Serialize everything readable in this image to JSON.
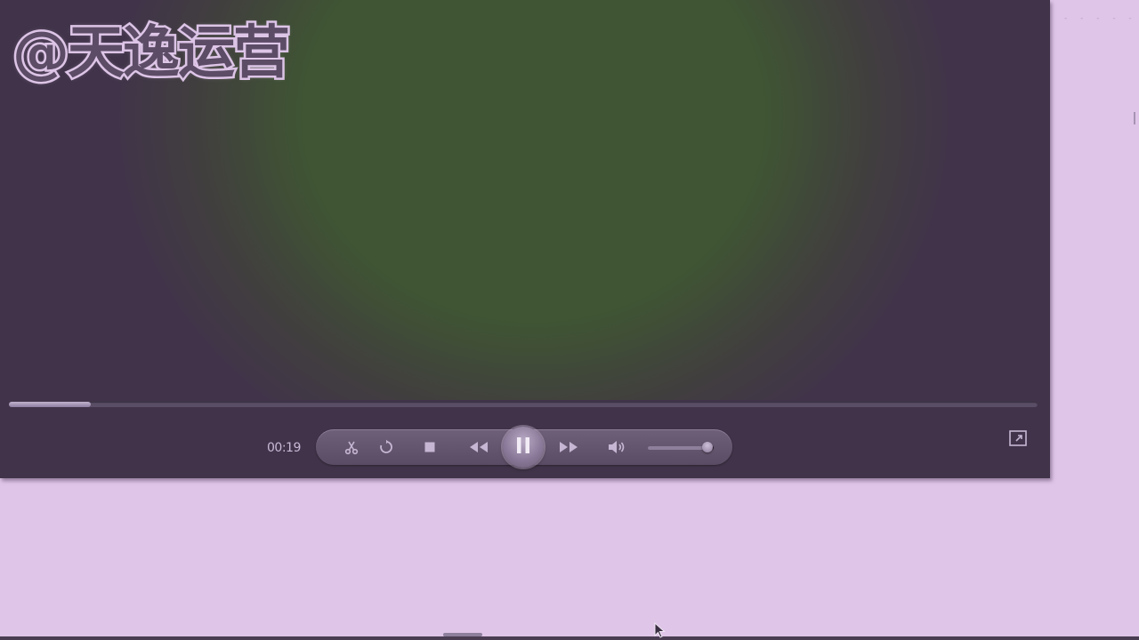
{
  "watermark": {
    "text": "@天逸运营"
  },
  "player": {
    "current_time": "00:19",
    "progress_fraction": 0.08,
    "volume_fraction": 0.9,
    "state": "playing"
  },
  "controls": {
    "buttons": [
      {
        "name": "clip",
        "icon": "scissors-icon"
      },
      {
        "name": "loop",
        "icon": "repeat-icon"
      },
      {
        "name": "stop",
        "icon": "stop-icon"
      },
      {
        "name": "rewind",
        "icon": "rewind-icon"
      },
      {
        "name": "pause",
        "icon": "pause-icon"
      },
      {
        "name": "fast-forward",
        "icon": "fast-forward-icon"
      },
      {
        "name": "volume",
        "icon": "speaker-icon"
      },
      {
        "name": "fullscreen",
        "icon": "fullscreen-icon"
      }
    ]
  },
  "colors": {
    "desktop": "#dfc5e8",
    "player_background": "#41344a",
    "video_tint": "#3f5533",
    "accent": "#c0b3ce"
  }
}
